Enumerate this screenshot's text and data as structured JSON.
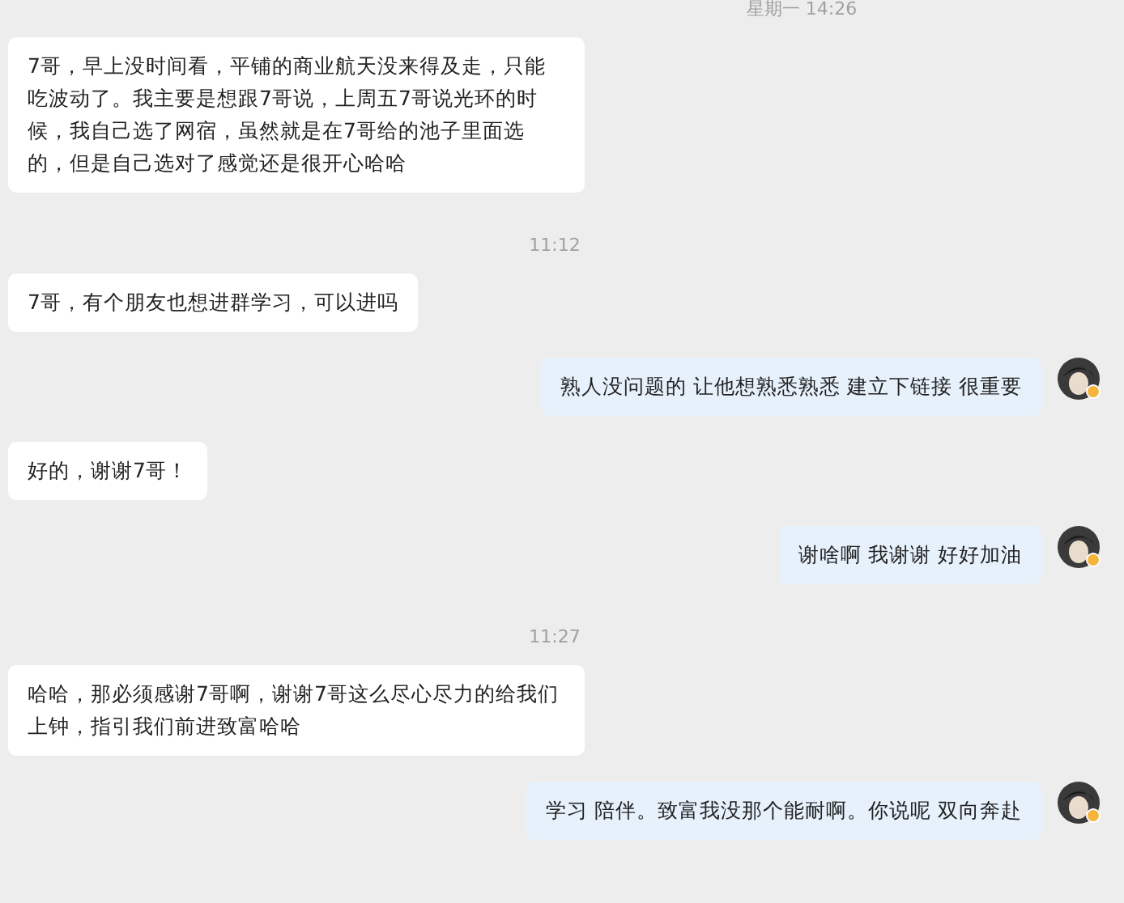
{
  "messages": [
    {
      "kind": "time",
      "text": "星期一 14:26"
    },
    {
      "kind": "received",
      "text": "7哥，早上没时间看，平铺的商业航天没来得及走，只能吃波动了。我主要是想跟7哥说，上周五7哥说光环的时候，我自己选了网宿，虽然就是在7哥给的池子里面选的，但是自己选对了感觉还是很开心哈哈"
    },
    {
      "kind": "time",
      "text": "11:12"
    },
    {
      "kind": "received",
      "text": "7哥，有个朋友也想进群学习，可以进吗"
    },
    {
      "kind": "sent",
      "text": "熟人没问题的  让他想熟悉熟悉  建立下链接 很重要"
    },
    {
      "kind": "received",
      "text": "好的，谢谢7哥！"
    },
    {
      "kind": "sent",
      "text": "谢啥啊  我谢谢  好好加油"
    },
    {
      "kind": "time",
      "text": "11:27"
    },
    {
      "kind": "received",
      "text": "哈哈，那必须感谢7哥啊，谢谢7哥这么尽心尽力的给我们上钟，指引我们前进致富哈哈"
    },
    {
      "kind": "sent",
      "text": "学习 陪伴。致富我没那个能耐啊。你说呢  双向奔赴"
    }
  ]
}
